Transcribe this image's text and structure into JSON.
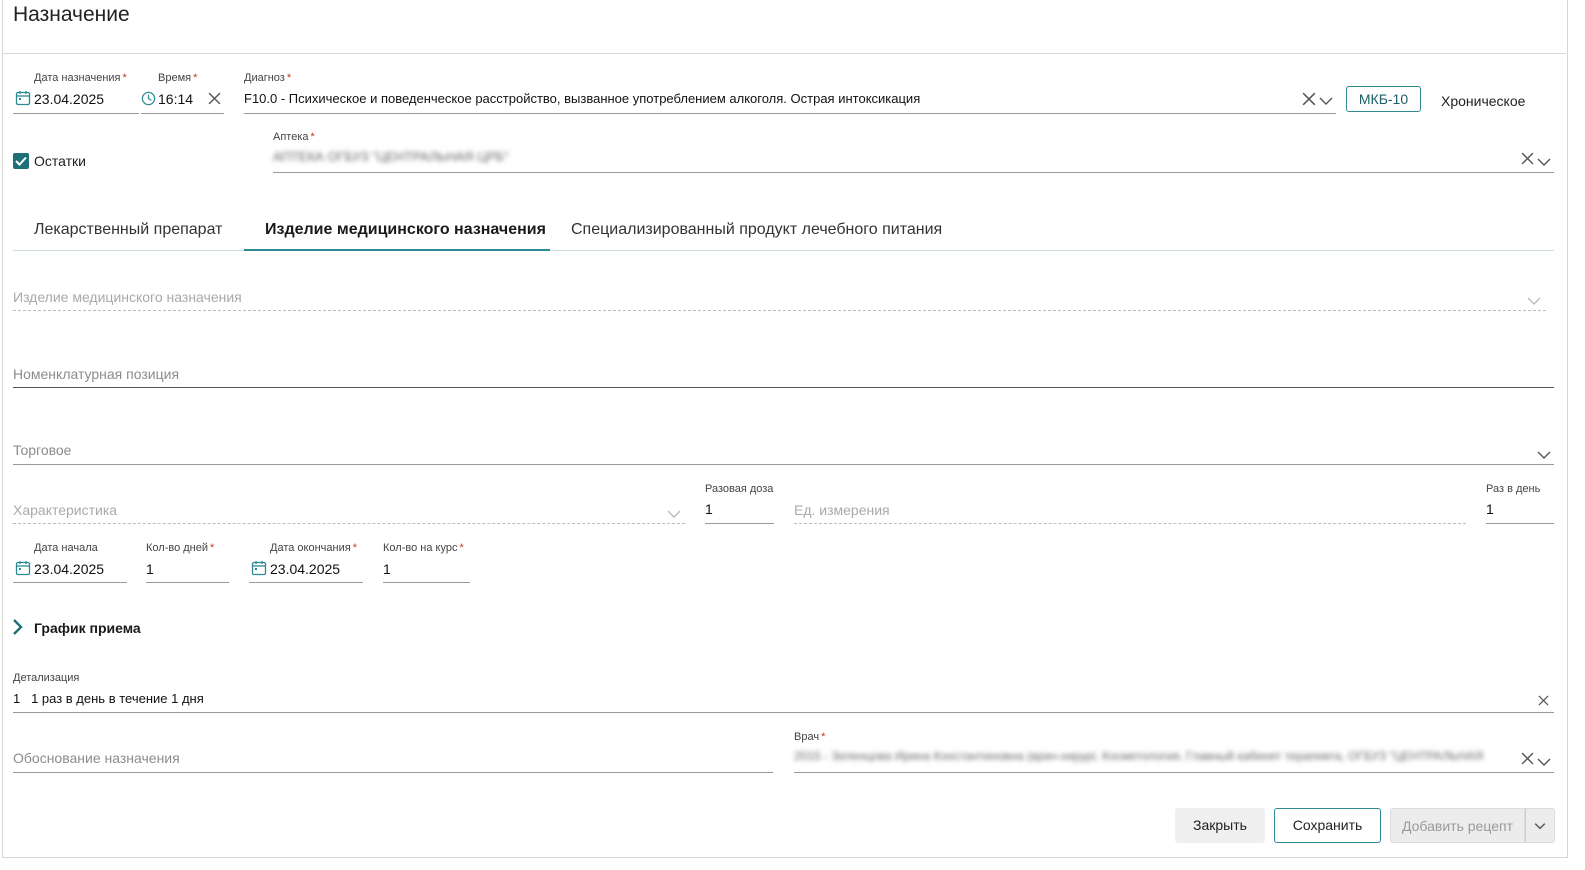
{
  "header": {
    "title": "Назначение"
  },
  "prescription": {
    "date_label": "Дата назначения",
    "date_value": "23.04.2025",
    "time_label": "Время",
    "time_value": "16:14",
    "diagnosis_label": "Диагноз",
    "diagnosis_value": "F10.0 - Психическое и поведенческое расстройство, вызванное употреблением алкоголя. Острая интоксикация",
    "mkb_button": "МКБ-10",
    "chronic_label": "Хроническое",
    "remains_label": "Остатки",
    "remains_checked": true,
    "pharmacy_label": "Аптека",
    "pharmacy_value": "АПТЕКА ОГБУЗ \"ЦЕНТРАЛЬНАЯ ЦРБ\""
  },
  "tabs": [
    {
      "label": "Лекарственный препарат",
      "active": false
    },
    {
      "label": "Изделие медицинского назначения",
      "active": true
    },
    {
      "label": "Специализированный продукт лечебного питания",
      "active": false
    }
  ],
  "item": {
    "device_placeholder": "Изделие медицинского назначения",
    "nomenclature_placeholder": "Номенклатурная позиция",
    "trade_placeholder": "Торговое",
    "characteristic_placeholder": "Характеристика",
    "dose_label": "Разовая доза",
    "dose_value": "1",
    "unit_placeholder": "Ед. измерения",
    "per_day_label": "Раз в день",
    "per_day_value": "1"
  },
  "course": {
    "start_label": "Дата начала",
    "start_value": "23.04.2025",
    "days_label": "Кол-во дней",
    "days_value": "1",
    "end_label": "Дата окончания",
    "end_value": "23.04.2025",
    "qty_label": "Кол-во на курс",
    "qty_value": "1"
  },
  "schedule": {
    "label": "График приема"
  },
  "details": {
    "label": "Детализация",
    "value": "1   1 раз в день в течение 1 дня"
  },
  "justification": {
    "placeholder": "Обоснование назначения"
  },
  "doctor": {
    "label": "Врач",
    "value": "2015 - Зеленцова Ирина Константиновна (врач-хирург, Косметология, Главный кабинет терапевта, ОГБУЗ \"ЦЕНТРАЛЬНАЯ"
  },
  "actions": {
    "close": "Закрыть",
    "save": "Сохранить",
    "add_recipe": "Добавить рецепт"
  },
  "colors": {
    "accent": "#1f8a93",
    "required": "#c0392b",
    "tab_underline": "#2c8a92"
  }
}
